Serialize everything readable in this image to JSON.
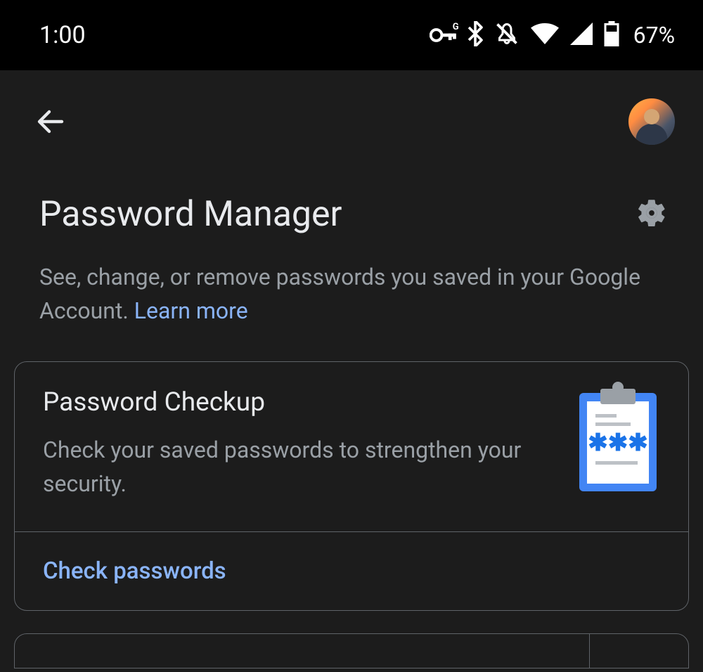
{
  "status_bar": {
    "time": "1:00",
    "battery_percent": "67%"
  },
  "header": {
    "page_title": "Password Manager",
    "description_text": "See, change, or remove passwords you saved in your Google Account. ",
    "learn_more_label": "Learn more"
  },
  "checkup_card": {
    "title": "Password Checkup",
    "subtitle": "Check your saved passwords to strengthen your security.",
    "action_label": "Check passwords"
  },
  "icons": {
    "vpn_key": "vpn-key-icon",
    "bluetooth": "bluetooth-icon",
    "dnd": "do-not-disturb-icon",
    "wifi": "wifi-icon",
    "signal": "signal-icon",
    "battery": "battery-icon",
    "back": "back-arrow-icon",
    "avatar": "profile-avatar",
    "gear": "settings-gear-icon",
    "clipboard": "password-checkup-clipboard-icon"
  }
}
